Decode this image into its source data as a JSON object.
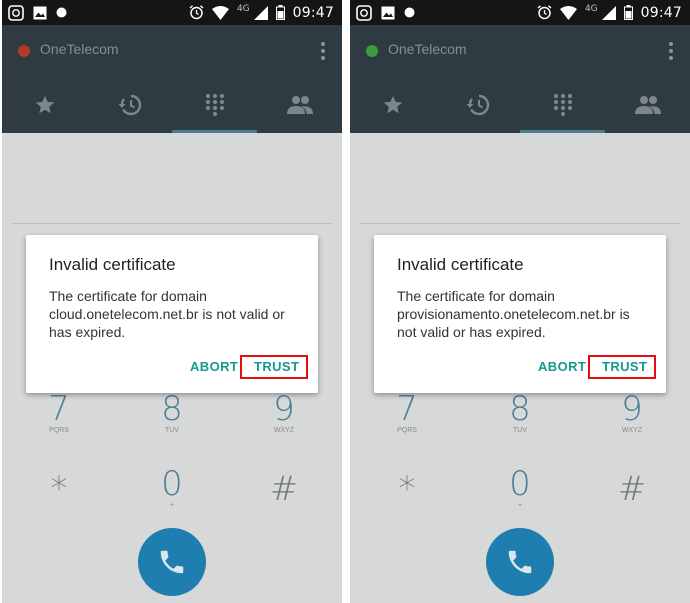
{
  "screens": [
    {
      "status_bar": {
        "time": "09:47",
        "network": "4G"
      },
      "app": {
        "title": "OneTelecom",
        "status_color": "#b23a29"
      },
      "tabs": [
        {
          "icon": "star-icon"
        },
        {
          "icon": "history-icon"
        },
        {
          "icon": "dialpad-icon",
          "selected": true
        },
        {
          "icon": "contacts-icon"
        }
      ],
      "dialpad": {
        "keys": [
          {
            "digit": "7",
            "letters": "PQRS"
          },
          {
            "digit": "8",
            "letters": "TUV"
          },
          {
            "digit": "9",
            "letters": "WXYZ"
          },
          {
            "digit": "*",
            "letters": ""
          },
          {
            "digit": "0",
            "letters": "+"
          },
          {
            "digit": "#",
            "letters": ""
          }
        ]
      },
      "dialog": {
        "title": "Invalid certificate",
        "message": "The certificate for domain cloud.onetelecom.net.br is not valid or has expired.",
        "abort_label": "ABORT",
        "trust_label": "TRUST",
        "highlight_color": "#e01010"
      }
    },
    {
      "status_bar": {
        "time": "09:47",
        "network": "4G"
      },
      "app": {
        "title": "OneTelecom",
        "status_color": "#3d9a3f"
      },
      "tabs": [
        {
          "icon": "star-icon"
        },
        {
          "icon": "history-icon"
        },
        {
          "icon": "dialpad-icon",
          "selected": true
        },
        {
          "icon": "contacts-icon"
        }
      ],
      "dialpad": {
        "keys": [
          {
            "digit": "7",
            "letters": "PQRS"
          },
          {
            "digit": "8",
            "letters": "TUV"
          },
          {
            "digit": "9",
            "letters": "WXYZ"
          },
          {
            "digit": "*",
            "letters": ""
          },
          {
            "digit": "0",
            "letters": "+"
          },
          {
            "digit": "#",
            "letters": ""
          }
        ]
      },
      "dialog": {
        "title": "Invalid certificate",
        "message": "The certificate for domain provisionamento.onetelecom.net.br is not valid or has expired.",
        "abort_label": "ABORT",
        "trust_label": "TRUST",
        "highlight_color": "#e01010"
      }
    }
  ]
}
